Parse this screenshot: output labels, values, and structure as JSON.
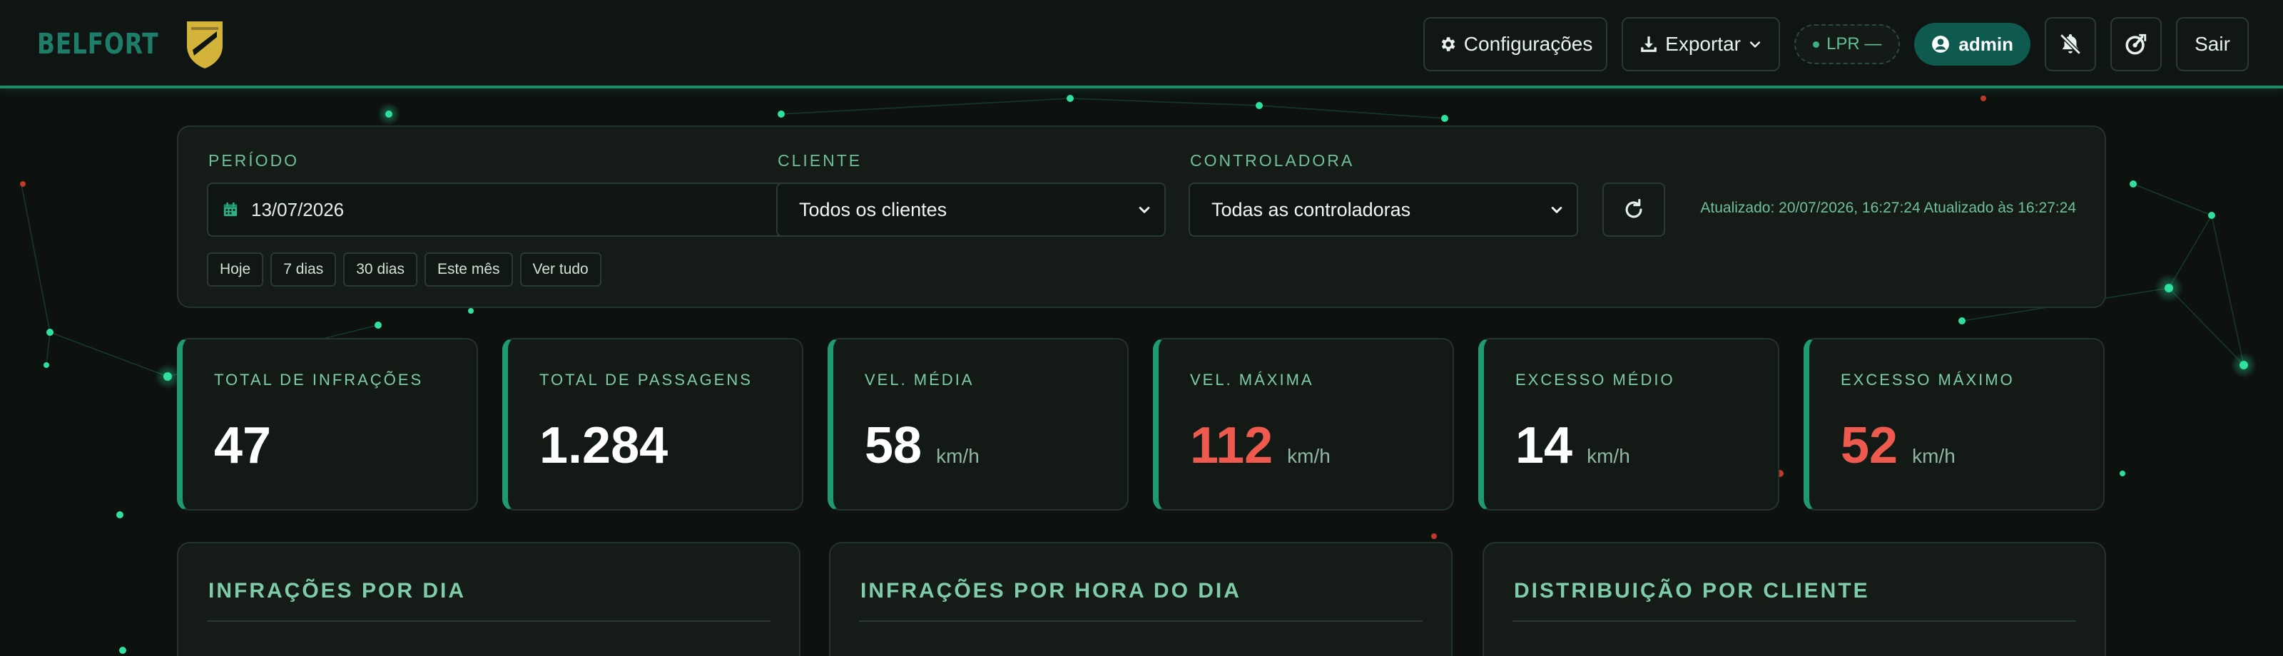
{
  "brand": {
    "name": "BELFORT",
    "colors": {
      "accent": "#1f9a72",
      "brand_text": "#1d7d68",
      "shield": "#d4b33a",
      "alert": "#ef5a4f"
    }
  },
  "header": {
    "settings_label": "Configurações",
    "export_label": "Exportar",
    "lpr_label": "LPR —",
    "user_label": "admin",
    "logout_label": "Sair",
    "icons": [
      "gear-icon",
      "download-icon",
      "chevron-down-icon",
      "user-circle-icon",
      "bell-off-icon",
      "gauge-icon"
    ]
  },
  "filters": {
    "period": {
      "label": "PERÍODO",
      "value": "13/07/2026"
    },
    "client": {
      "label": "CLIENTE",
      "selected": "Todos os clientes"
    },
    "controller": {
      "label": "CONTROLADORA",
      "selected": "Todas as controladoras"
    },
    "updated_text": "Atualizado: 20/07/2026, 16:27:24  Atualizado às 16:27:24",
    "quick_ranges": [
      "Hoje",
      "7 dias",
      "30 dias",
      "Este mês",
      "Ver tudo"
    ]
  },
  "kpis": [
    {
      "label": "TOTAL DE INFRAÇÕES",
      "value": "47",
      "unit": "",
      "alert": false
    },
    {
      "label": "TOTAL DE PASSAGENS",
      "value": "1.284",
      "unit": "",
      "alert": false
    },
    {
      "label": "VEL. MÉDIA",
      "value": "58",
      "unit": "km/h",
      "alert": false
    },
    {
      "label": "VEL. MÁXIMA",
      "value": "112",
      "unit": "km/h",
      "alert": true
    },
    {
      "label": "EXCESSO MÉDIO",
      "value": "14",
      "unit": "km/h",
      "alert": false
    },
    {
      "label": "EXCESSO MÁXIMO",
      "value": "52",
      "unit": "km/h",
      "alert": true
    }
  ],
  "charts": [
    {
      "title": "INFRAÇÕES POR DIA"
    },
    {
      "title": "INFRAÇÕES POR HORA DO DIA"
    },
    {
      "title": "DISTRIBUIÇÃO POR CLIENTE"
    }
  ]
}
